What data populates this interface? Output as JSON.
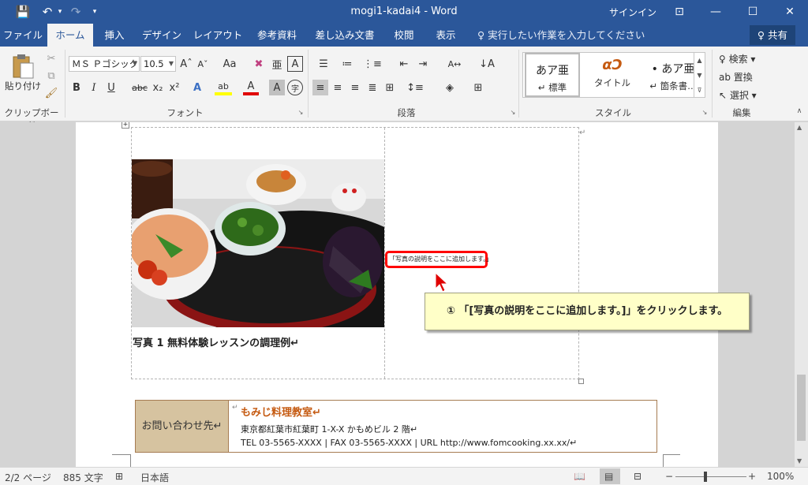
{
  "titlebar": {
    "title": "mogi1-kadai4  -  Word",
    "signin": "サインイン",
    "save_icon": "💾",
    "undo_icon": "↶",
    "redo_icon": "↷",
    "qat_more": "▾",
    "ribbon_display_icon": "⊡",
    "minimize": "—",
    "maximize": "☐",
    "close": "✕"
  },
  "tabs": [
    "ファイル",
    "ホーム",
    "挿入",
    "デザイン",
    "レイアウト",
    "参考資料",
    "差し込み文書",
    "校閲",
    "表示"
  ],
  "active_tab": "ホーム",
  "tell_me": "♀ 実行したい作業を入力してください",
  "share": "♀ 共有",
  "ribbon": {
    "clipboard": {
      "paste": "貼り付け",
      "label": "クリップボード"
    },
    "font": {
      "font_name": "ＭＳ Ｐゴシック",
      "font_size": "10.5",
      "grow": "Aˆ",
      "shrink": "Aˇ",
      "case": "Aa",
      "clear": "✖",
      "phonetic": "亜",
      "border_char": "A",
      "bold": "B",
      "italic": "I",
      "underline": "U",
      "strike": "abc",
      "subscript": "x₂",
      "superscript": "x²",
      "effects": "A",
      "highlight": "ab",
      "font_color": "A",
      "shading": "A",
      "enclose": "字",
      "label": "フォント"
    },
    "paragraph": {
      "label": "段落"
    },
    "styles": {
      "items": [
        {
          "big": "あア亜",
          "small": "↵ 標準"
        },
        {
          "big": "αↃ",
          "small": "タイトル"
        },
        {
          "big": "• あア亜",
          "small": "↵ 箇条書…"
        }
      ],
      "label": "スタイル"
    },
    "editing": {
      "find": "♀ 検索 ▾",
      "replace": "ab 置換",
      "select": "↖ 選択 ▾",
      "label": "編集"
    }
  },
  "document": {
    "caption": "写真 1 無料体験レッスンの調理例↵",
    "caption_placeholder": "「写真の説明をここに追加します。」",
    "callout": "① 「[写真の説明をここに追加します。]」をクリックします。",
    "contact": {
      "label": "お問い合わせ先↵",
      "name": "もみじ料理教室↵",
      "address": "東京都紅葉市紅葉町 1-X-X かもめビル 2 階↵",
      "tel": "TEL  03-5565-XXXX | FAX  03-5565-XXXX | URL  http://www.fomcooking.xx.xx/↵"
    },
    "end_mark": "↵"
  },
  "statusbar": {
    "page": "2/2 ページ",
    "words": "885 文字",
    "proof_icon": "⊞",
    "language": "日本語",
    "zoom": "100%",
    "zoom_minus": "−",
    "zoom_plus": "+"
  }
}
